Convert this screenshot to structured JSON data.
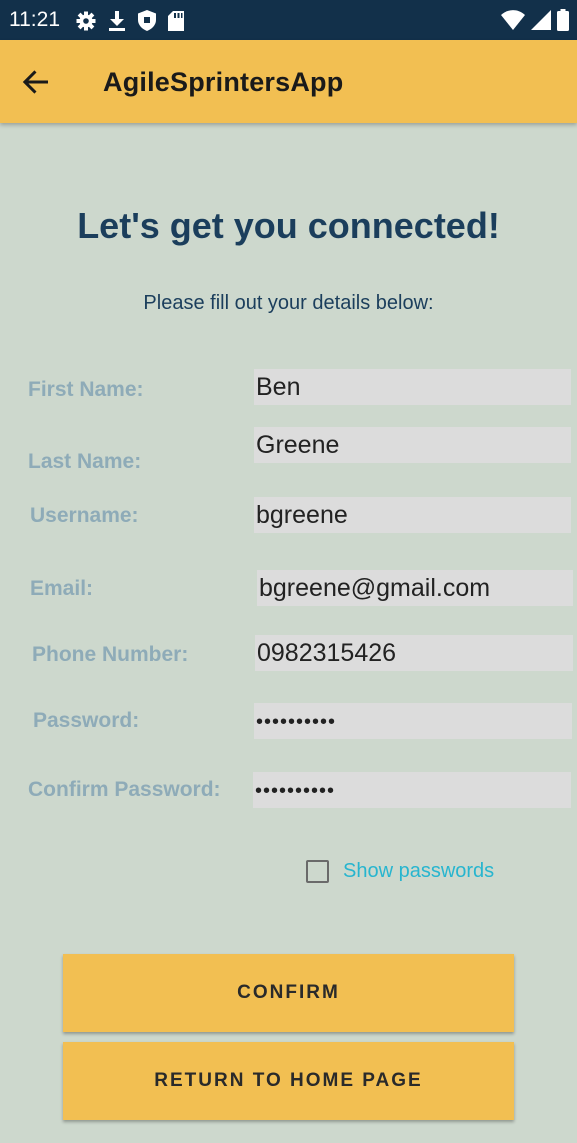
{
  "status_bar": {
    "time": "11:21",
    "left_icons": [
      "gear-icon",
      "download-icon",
      "shield-icon",
      "sd-card-icon"
    ],
    "right_icons": [
      "wifi-icon",
      "signal-icon",
      "battery-icon"
    ]
  },
  "app_bar": {
    "title": "AgileSprintersApp",
    "back_icon": "arrow-left-icon"
  },
  "page": {
    "heading": "Let's get you connected!",
    "subheading": "Please fill out your details below:"
  },
  "form": {
    "first_name": {
      "label": "First Name:",
      "value": "Ben"
    },
    "last_name": {
      "label": "Last Name:",
      "value": "Greene"
    },
    "username": {
      "label": "Username:",
      "value": "bgreene"
    },
    "email": {
      "label": "Email:",
      "value": "bgreene@gmail.com"
    },
    "phone": {
      "label": "Phone Number:",
      "value": "0982315426"
    },
    "password": {
      "label": "Password:",
      "value": "••••••••••"
    },
    "confirm_password": {
      "label": "Confirm Password:",
      "value": "••••••••••"
    },
    "show_passwords": {
      "label": "Show passwords",
      "checked": false
    }
  },
  "buttons": {
    "confirm": "CONFIRM",
    "return_home": "RETURN TO HOME PAGE"
  },
  "colors": {
    "accent": "#f2bf52",
    "background": "#cdd8cd",
    "status_bar": "#12304a",
    "heading": "#1b3e5c",
    "label": "#8eabb8",
    "link": "#27b5cf"
  }
}
